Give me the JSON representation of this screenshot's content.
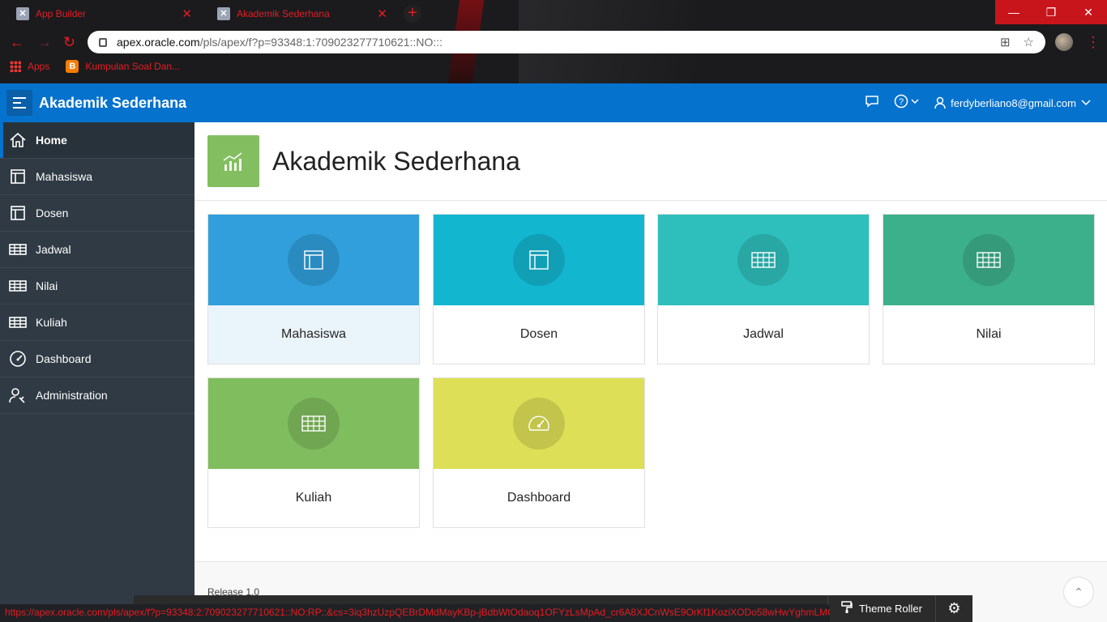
{
  "browser": {
    "tabs": [
      {
        "title": "App Builder"
      },
      {
        "title": "Akademik Sederhana"
      }
    ],
    "url_host": "apex.oracle.com",
    "url_path": "/pls/apex/f?p=93348:1:709023277710621::NO:::",
    "bookmarks": [
      {
        "label": "Apps"
      },
      {
        "label": "Kumpulan Soal Dan..."
      }
    ],
    "status_url": "https://apex.oracle.com/pls/apex/f?p=93348:2:709023277710621::NO:RP::&cs=3iq3hzUzpQEBrDMdMayKBp-jBdbWtOdaoq1OFYzLsMpAd_cr6A8XJCnWsE9OrKf1KoziXODo58wHwYghmLMOikQ"
  },
  "header": {
    "app_title": "Akademik Sederhana",
    "user": "ferdyberliano8@gmail.com"
  },
  "sidebar": {
    "items": [
      {
        "label": "Home"
      },
      {
        "label": "Mahasiswa"
      },
      {
        "label": "Dosen"
      },
      {
        "label": "Jadwal"
      },
      {
        "label": "Nilai"
      },
      {
        "label": "Kuliah"
      },
      {
        "label": "Dashboard"
      },
      {
        "label": "Administration"
      }
    ]
  },
  "page": {
    "title": "Akademik Sederhana"
  },
  "cards": [
    {
      "label": "Mahasiswa",
      "color": "#309fdb",
      "icon": "form-icon"
    },
    {
      "label": "Dosen",
      "color": "#13b6cf",
      "icon": "form-icon"
    },
    {
      "label": "Jadwal",
      "color": "#2ebfbc",
      "icon": "table-icon"
    },
    {
      "label": "Nilai",
      "color": "#3cb08a",
      "icon": "table-icon"
    },
    {
      "label": "Kuliah",
      "color": "#80bd5e",
      "icon": "table-icon"
    },
    {
      "label": "Dashboard",
      "color": "#dde056",
      "icon": "speedometer-icon"
    }
  ],
  "footer": {
    "release": "Release 1.0"
  },
  "devbar": {
    "theme_roller": "Theme Roller"
  }
}
